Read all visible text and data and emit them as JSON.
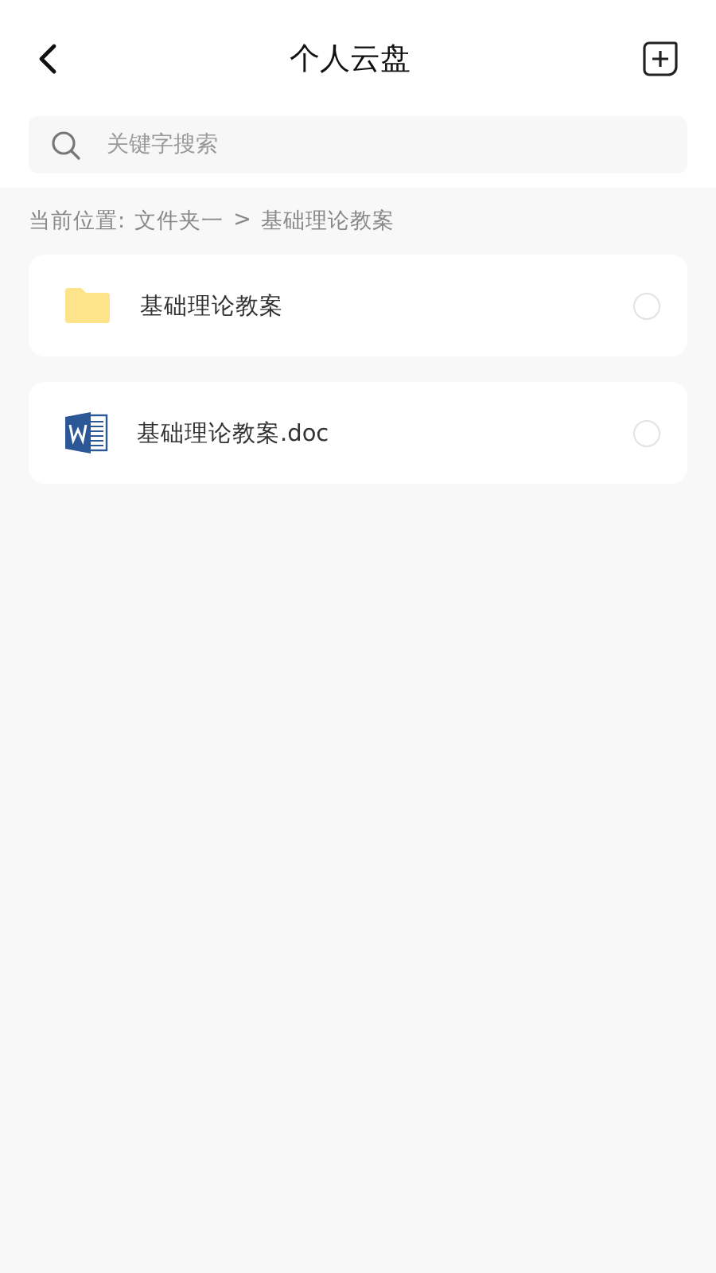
{
  "header": {
    "title": "个人云盘"
  },
  "search": {
    "placeholder": "关键字搜索"
  },
  "breadcrumb": {
    "label": "当前位置:",
    "path": [
      "文件夹一",
      "基础理论教案"
    ],
    "separator": ">"
  },
  "files": [
    {
      "kind": "folder",
      "name": "基础理论教案",
      "selected": false
    },
    {
      "kind": "doc",
      "name": "基础理论教案.doc",
      "selected": false
    }
  ]
}
